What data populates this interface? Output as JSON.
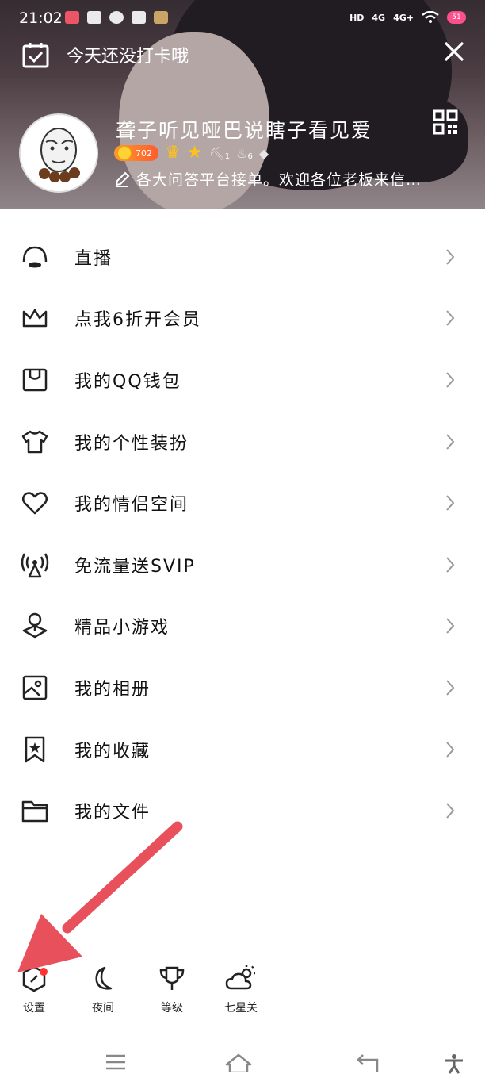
{
  "status_bar": {
    "time": "21:02",
    "right": [
      "HD",
      "4G",
      "4G+",
      "51"
    ]
  },
  "header": {
    "checkin_text": "今天还没打卡哦",
    "nickname": "聋子听见哑巴说瞎子看见爱",
    "level": "702",
    "badge_counts": [
      "1",
      "6"
    ],
    "signature": "各大问答平台接单。欢迎各位老板来信…"
  },
  "menu": {
    "items": [
      {
        "label": "直播",
        "icon": "live-icon"
      },
      {
        "label": "点我6折开会员",
        "icon": "crown-icon"
      },
      {
        "label": "我的QQ钱包",
        "icon": "wallet-icon"
      },
      {
        "label": "我的个性装扮",
        "icon": "tshirt-icon"
      },
      {
        "label": "我的情侣空间",
        "icon": "heart-icon"
      },
      {
        "label": "免流量送SVIP",
        "icon": "antenna-icon"
      },
      {
        "label": "精品小游戏",
        "icon": "game-pin-icon"
      },
      {
        "label": "我的相册",
        "icon": "photo-icon"
      },
      {
        "label": "我的收藏",
        "icon": "bookmark-star-icon"
      },
      {
        "label": "我的文件",
        "icon": "folder-icon"
      }
    ]
  },
  "toolbar": {
    "settings": "设置",
    "night": "夜间",
    "level": "等级",
    "weather": "七星关"
  },
  "colors": {
    "accent_red": "#e8505b",
    "badge_orange": "#ff7a2a",
    "crown_gold": "#ffc21a"
  }
}
